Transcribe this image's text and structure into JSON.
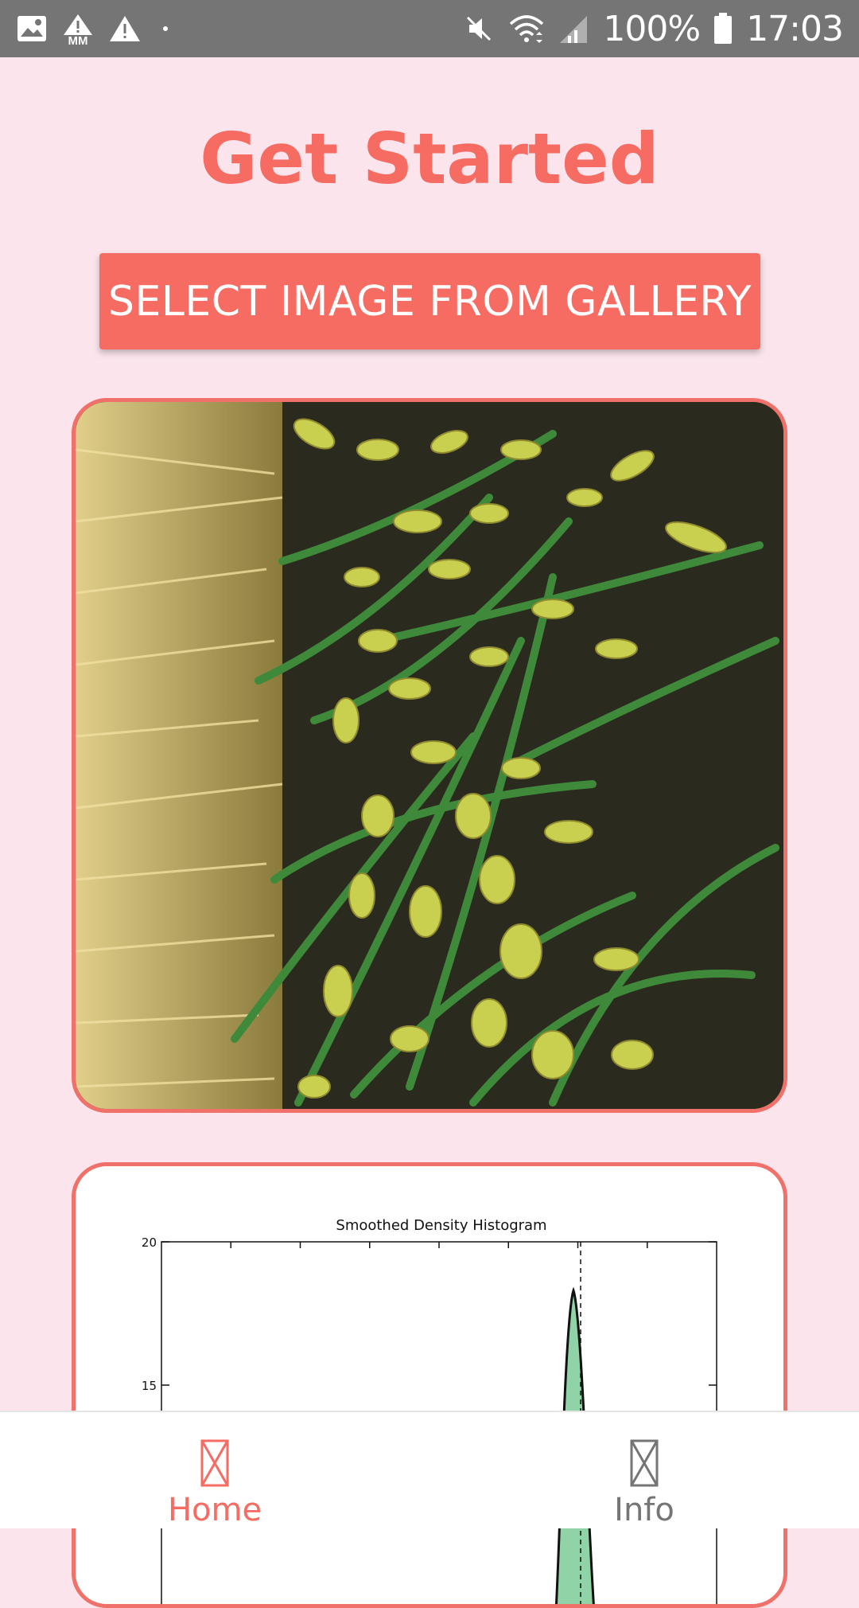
{
  "status_bar": {
    "battery_percent": "100%",
    "time": "17:03",
    "left_icons": [
      "image-icon",
      "mm-warning-icon",
      "warning-icon",
      "dot-icon"
    ],
    "right_icons": [
      "mute-icon",
      "wifi-icon",
      "signal-icon",
      "battery-icon"
    ]
  },
  "page": {
    "title": "Get Started",
    "select_button_label": "SELECT IMAGE FROM GALLERY",
    "mm_label": "MM"
  },
  "photo": {
    "subject": "green-grass-seed-heads-photo"
  },
  "chart_data": {
    "type": "area",
    "title": "Smoothed Density Histogram",
    "ylim": [
      0,
      20
    ],
    "yticks": [
      "20",
      "15"
    ],
    "peak_y": 18.3,
    "marker_line": "dashed-vertical",
    "fill_color": "#8fd3a6"
  },
  "nav": {
    "items": [
      {
        "label": "Home",
        "active": true
      },
      {
        "label": "Info",
        "active": false
      }
    ]
  },
  "colors": {
    "accent": "#f66b62",
    "background": "#fbe4ec",
    "status_bar": "#757575",
    "inactive": "#757575"
  }
}
